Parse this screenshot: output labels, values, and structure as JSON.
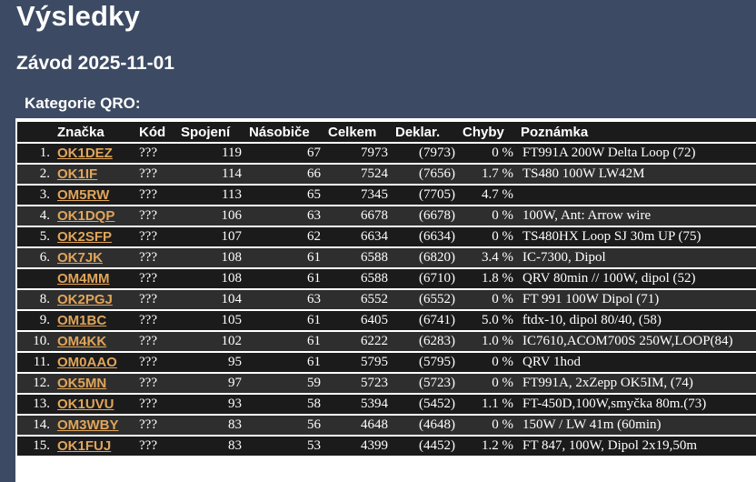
{
  "page": {
    "title": "Výsledky",
    "contest": "Závod 2025-11-01",
    "category": "Kategorie QRO:"
  },
  "colors": {
    "background": "#3d4a63",
    "callsign_link": "#e0a55a",
    "row_dark": "#1b1b1b",
    "row_alt": "#2e2e2e"
  },
  "table": {
    "headers": [
      "",
      "Značka",
      "Kód",
      "Spojení",
      "Násobiče",
      "Celkem",
      "Deklar.",
      "Chyby",
      "Poznámka"
    ],
    "rows": [
      {
        "rank": "1.",
        "call": "OK1DEZ",
        "code": "???",
        "qso": "119",
        "mult": "67",
        "total": "7973",
        "decl": "(7973)",
        "err": "0 %",
        "note": "FT991A 200W Delta Loop (72)"
      },
      {
        "rank": "2.",
        "call": "OK1IF",
        "code": "???",
        "qso": "114",
        "mult": "66",
        "total": "7524",
        "decl": "(7656)",
        "err": "1.7 %",
        "note": "TS480 100W LW42M"
      },
      {
        "rank": "3.",
        "call": "OM5RW",
        "code": "???",
        "qso": "113",
        "mult": "65",
        "total": "7345",
        "decl": "(7705)",
        "err": "4.7 %",
        "note": ""
      },
      {
        "rank": "4.",
        "call": "OK1DQP",
        "code": "???",
        "qso": "106",
        "mult": "63",
        "total": "6678",
        "decl": "(6678)",
        "err": "0 %",
        "note": "100W, Ant: Arrow wire"
      },
      {
        "rank": "5.",
        "call": "OK2SFP",
        "code": "???",
        "qso": "107",
        "mult": "62",
        "total": "6634",
        "decl": "(6634)",
        "err": "0 %",
        "note": "TS480HX Loop SJ 30m UP (75)"
      },
      {
        "rank": "6.",
        "call": "OK7JK",
        "code": "???",
        "qso": "108",
        "mult": "61",
        "total": "6588",
        "decl": "(6820)",
        "err": "3.4 %",
        "note": "IC-7300, Dipol"
      },
      {
        "rank": "",
        "call": "OM4MM",
        "code": "???",
        "qso": "108",
        "mult": "61",
        "total": "6588",
        "decl": "(6710)",
        "err": "1.8 %",
        "note": "QRV 80min // 100W, dipol (52)"
      },
      {
        "rank": "8.",
        "call": "OK2PGJ",
        "code": "???",
        "qso": "104",
        "mult": "63",
        "total": "6552",
        "decl": "(6552)",
        "err": "0 %",
        "note": "FT 991 100W Dipol (71)"
      },
      {
        "rank": "9.",
        "call": "OM1BC",
        "code": "???",
        "qso": "105",
        "mult": "61",
        "total": "6405",
        "decl": "(6741)",
        "err": "5.0 %",
        "note": "ftdx-10, dipol 80/40, (58)"
      },
      {
        "rank": "10.",
        "call": "OM4KK",
        "code": "???",
        "qso": "102",
        "mult": "61",
        "total": "6222",
        "decl": "(6283)",
        "err": "1.0 %",
        "note": "IC7610,ACOM700S 250W,LOOP(84)"
      },
      {
        "rank": "11.",
        "call": "OM0AAO",
        "code": "???",
        "qso": "95",
        "mult": "61",
        "total": "5795",
        "decl": "(5795)",
        "err": "0 %",
        "note": "QRV 1hod"
      },
      {
        "rank": "12.",
        "call": "OK5MN",
        "code": "???",
        "qso": "97",
        "mult": "59",
        "total": "5723",
        "decl": "(5723)",
        "err": "0 %",
        "note": "FT991A, 2xZepp OK5IM, (74)"
      },
      {
        "rank": "13.",
        "call": "OK1UVU",
        "code": "???",
        "qso": "93",
        "mult": "58",
        "total": "5394",
        "decl": "(5452)",
        "err": "1.1 %",
        "note": "FT-450D,100W,smyčka 80m.(73)"
      },
      {
        "rank": "14.",
        "call": "OM3WBY",
        "code": "???",
        "qso": "83",
        "mult": "56",
        "total": "4648",
        "decl": "(4648)",
        "err": "0 %",
        "note": "150W / LW 41m (60min)"
      },
      {
        "rank": "15.",
        "call": "OK1FUJ",
        "code": "???",
        "qso": "83",
        "mult": "53",
        "total": "4399",
        "decl": "(4452)",
        "err": "1.2 %",
        "note": "FT 847, 100W, Dipol 2x19,50m"
      }
    ]
  }
}
